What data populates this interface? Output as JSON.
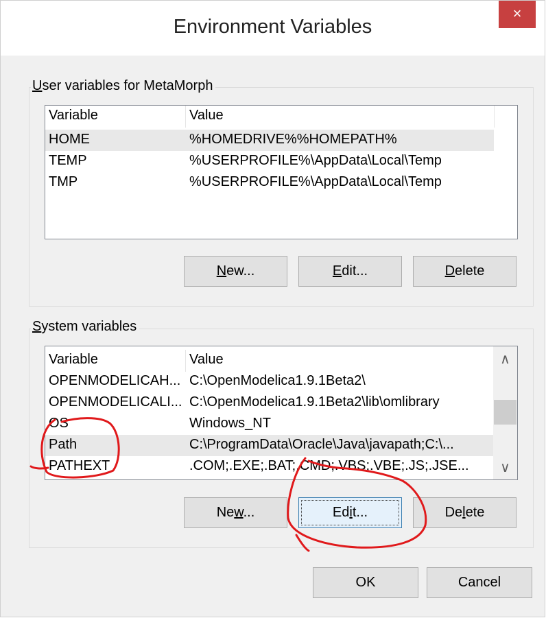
{
  "window": {
    "title": "Environment Variables",
    "close_glyph": "×"
  },
  "user_group": {
    "label_key": "U",
    "label_rest": "ser variables for MetaMorph",
    "columns": [
      "Variable",
      "Value"
    ],
    "rows": [
      {
        "variable": "HOME",
        "value": "%HOMEDRIVE%%HOMEPATH%"
      },
      {
        "variable": "TEMP",
        "value": "%USERPROFILE%\\AppData\\Local\\Temp"
      },
      {
        "variable": "TMP",
        "value": "%USERPROFILE%\\AppData\\Local\\Temp"
      }
    ],
    "buttons": {
      "new_key": "N",
      "new_rest": "ew...",
      "edit_key": "E",
      "edit_rest": "dit...",
      "delete_key": "D",
      "delete_rest": "elete"
    }
  },
  "system_group": {
    "label_key": "S",
    "label_rest": "ystem variables",
    "columns": [
      "Variable",
      "Value"
    ],
    "rows": [
      {
        "variable": "OPENMODELICAH...",
        "value": "C:\\OpenModelica1.9.1Beta2\\"
      },
      {
        "variable": "OPENMODELICALI...",
        "value": "C:\\OpenModelica1.9.1Beta2\\lib\\omlibrary"
      },
      {
        "variable": "OS",
        "value": "Windows_NT"
      },
      {
        "variable": "Path",
        "value": "C:\\ProgramData\\Oracle\\Java\\javapath;C:\\..."
      },
      {
        "variable": "PATHEXT",
        "value": ".COM;.EXE;.BAT;.CMD;.VBS;.VBE;.JS;.JSE..."
      }
    ],
    "buttons": {
      "new_pre": "Ne",
      "new_key": "w",
      "new_post": "...",
      "edit_pre": "Ed",
      "edit_key": "i",
      "edit_post": "t...",
      "delete_pre": "De",
      "delete_key": "l",
      "delete_post": "ete"
    },
    "scroll_up": "∧",
    "scroll_down": "∨"
  },
  "footer": {
    "ok": "OK",
    "cancel": "Cancel"
  },
  "colors": {
    "annotation": "#e0191b",
    "close_bg": "#c74040",
    "selected_row": "#e8e8e8"
  }
}
